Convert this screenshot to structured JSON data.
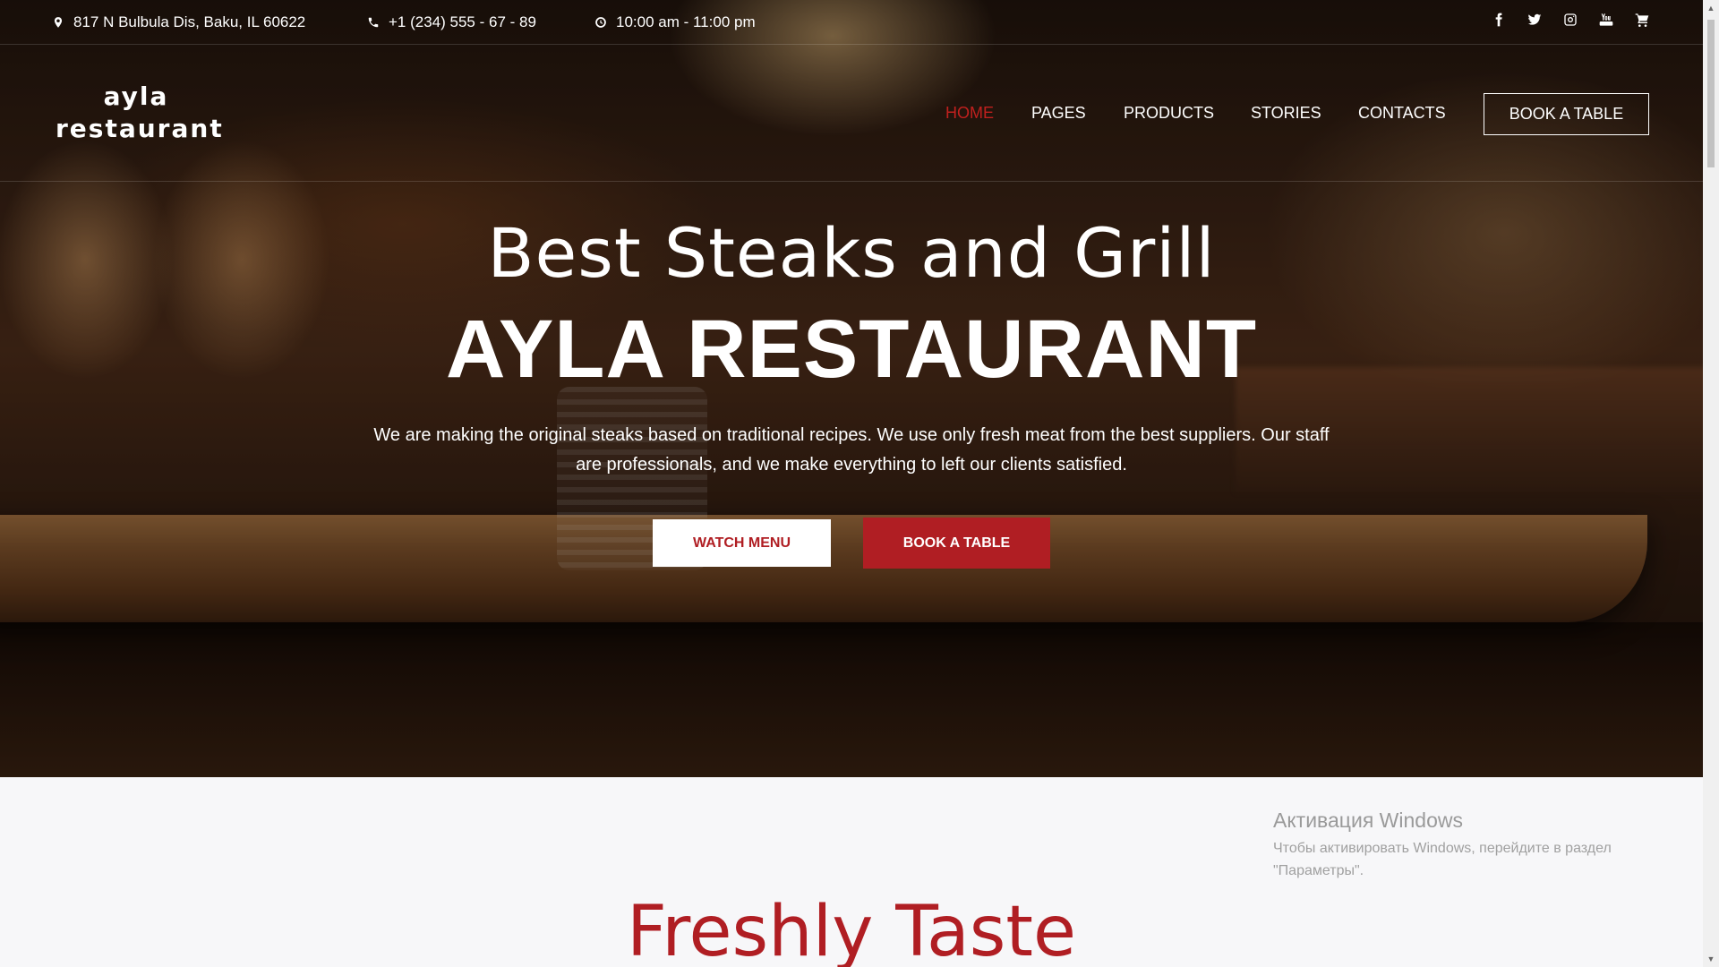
{
  "topbar": {
    "address": "817 N Bulbula Dis, Baku, IL 60622",
    "phone": "+1 (234) 555 - 67 - 89",
    "hours": "10:00 am - 11:00 pm",
    "socials": [
      "facebook-icon",
      "twitter-icon",
      "instagram-icon",
      "youtube-icon",
      "cart-icon"
    ]
  },
  "logo": {
    "line1": "ayla",
    "line2": "restaurant"
  },
  "nav": {
    "home": "HOME",
    "pages": "PAGES",
    "products": "PRODUCTS",
    "stories": "STORIES",
    "contacts": "CONTACTS",
    "book": "BOOK A TABLE",
    "active_color": "#c0201e"
  },
  "hero": {
    "script_title": "Best Steaks and Grill",
    "title": "AYLA RESTAURANT",
    "text": "We are making the original steaks based on traditional recipes. We use only fresh meat from the best suppliers. Our staff are professionals, and we make everything to left our clients satisfied.",
    "watch_menu": "WATCH MENU",
    "book_table": "BOOK A TABLE"
  },
  "section": {
    "heading": "Freshly Taste"
  },
  "windows": {
    "title": "Активация Windows",
    "text": "Чтобы активировать Windows, перейдите в раздел \"Параметры\"."
  },
  "colors": {
    "brand_red": "#b01e23"
  }
}
